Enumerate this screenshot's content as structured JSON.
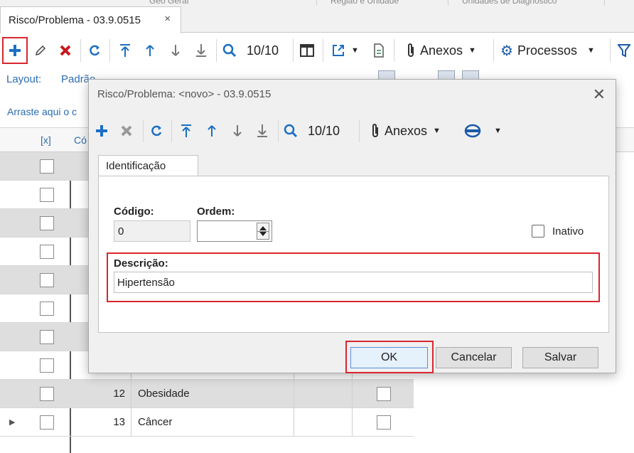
{
  "background": {
    "top_fragments": [
      "Geo Geral",
      "Região e Unidade",
      "Unidades de Diagnóstico"
    ],
    "doc_tab": {
      "title": "Risco/Problema - 03.9.0515",
      "close": "×"
    },
    "toolbar": {
      "counter": "10/10",
      "anexos_label": "Anexos",
      "processos_label": "Processos",
      "icons": [
        "add-icon",
        "edit-icon",
        "delete-icon",
        "refresh-icon",
        "first-icon",
        "prev-icon",
        "next-icon",
        "last-icon",
        "search-icon",
        "columns-icon",
        "export-icon",
        "document-icon",
        "paperclip-icon",
        "gear-icon",
        "filter-icon"
      ]
    },
    "layout_bar": {
      "layout_label": "Layout:",
      "layout_value": "Padrão"
    },
    "group_hint": "Arraste aqui o c",
    "grid": {
      "headers": {
        "select": "[x]",
        "code": "Có"
      },
      "rows": [
        {
          "code": "",
          "description": "",
          "alt": true
        },
        {
          "code": "",
          "description": "",
          "alt": false
        },
        {
          "code": "",
          "description": "",
          "alt": true
        },
        {
          "code": "",
          "description": "",
          "alt": false
        },
        {
          "code": "",
          "description": "",
          "alt": true
        },
        {
          "code": "",
          "description": "",
          "alt": false
        },
        {
          "code": "",
          "description": "",
          "alt": true
        },
        {
          "code": "",
          "description": "",
          "alt": false
        },
        {
          "code": "12",
          "description": "Obesidade",
          "alt": true
        },
        {
          "code": "13",
          "description": "Câncer",
          "alt": false
        }
      ]
    }
  },
  "dialog": {
    "title": "Risco/Problema: <novo> - 03.9.0515",
    "close": "✕",
    "toolbar": {
      "counter": "10/10",
      "anexos_label": "Anexos"
    },
    "tab_label": "Identificação",
    "fields": {
      "codigo_label": "Código:",
      "codigo_value": "0",
      "ordem_label": "Ordem:",
      "ordem_value": "",
      "inativo_label": "Inativo",
      "descricao_label": "Descrição:",
      "descricao_value": "Hipertensão"
    },
    "buttons": {
      "ok": "OK",
      "cancel": "Cancelar",
      "save": "Salvar"
    }
  },
  "colors": {
    "highlight": "#d9262f",
    "accent_blue": "#2b6cb0",
    "delete_red": "#c8161e"
  }
}
